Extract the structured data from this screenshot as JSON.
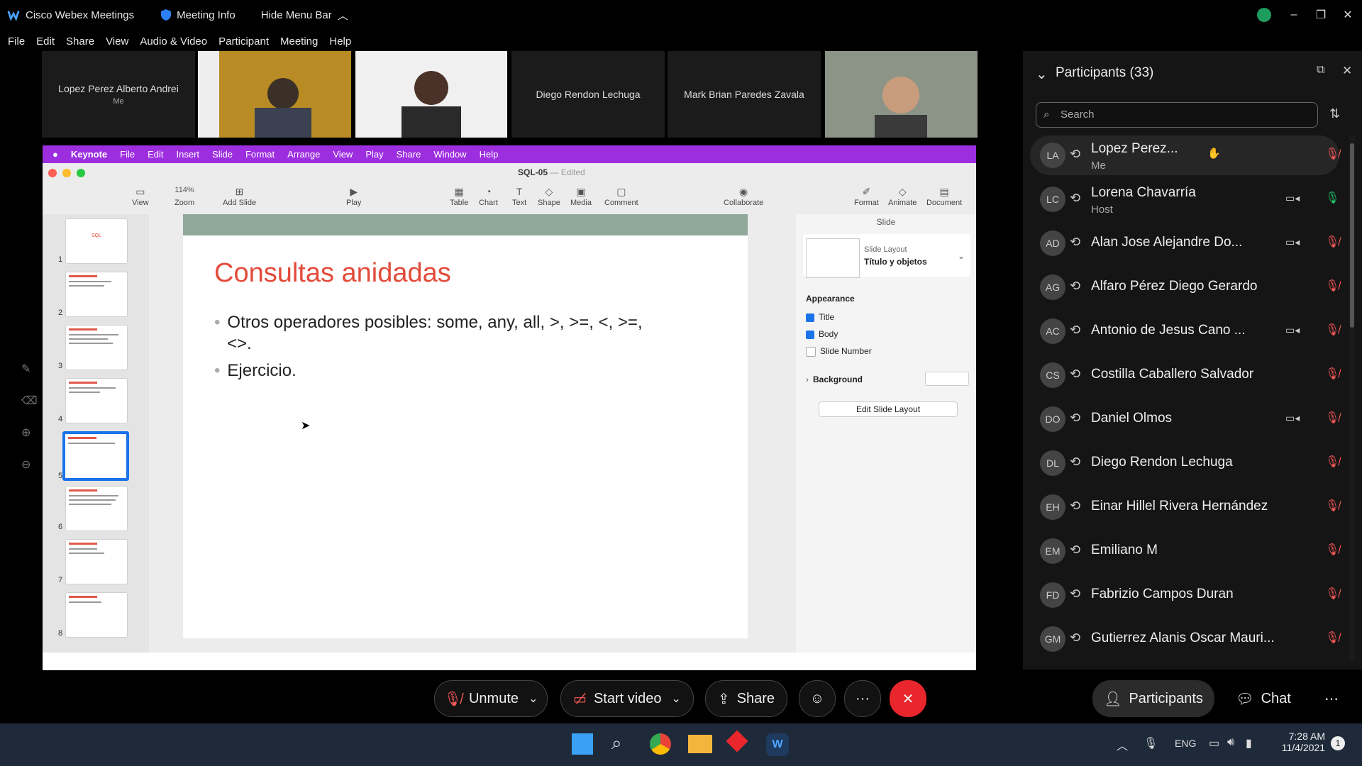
{
  "titlebar": {
    "app": "Cisco Webex Meetings",
    "meeting_info": "Meeting Info",
    "hide_menu": "Hide Menu Bar"
  },
  "menubar": [
    "File",
    "Edit",
    "Share",
    "View",
    "Audio & Video",
    "Participant",
    "Meeting",
    "Help"
  ],
  "videos": [
    {
      "name": "Lopez Perez Alberto Andrei",
      "sub": "Me"
    },
    {
      "name": "Diego Rendon Lechuga"
    },
    {
      "name": "Mark Brian Paredes Zavala"
    }
  ],
  "keynote": {
    "menu": [
      "Keynote",
      "File",
      "Edit",
      "Insert",
      "Slide",
      "Format",
      "Arrange",
      "View",
      "Play",
      "Share",
      "Window",
      "Help"
    ],
    "doc_title": "SQL-05",
    "doc_status": "— Edited",
    "zoom": "114%",
    "tools": {
      "view": "View",
      "zoom": "Zoom",
      "add_slide": "Add Slide",
      "play": "Play",
      "table": "Table",
      "chart": "Chart",
      "text": "Text",
      "shape": "Shape",
      "media": "Media",
      "comment": "Comment",
      "collaborate": "Collaborate",
      "format": "Format",
      "animate": "Animate",
      "document": "Document"
    },
    "slide_numbers": [
      "1",
      "2",
      "3",
      "4",
      "5",
      "6",
      "7",
      "8"
    ],
    "thumb1_text": "SQL",
    "slide": {
      "title": "Consultas anidadas",
      "bullet1": "Otros operadores posibles: some, any, all, >, >=, <, >=,",
      "bullet1b": "<>.",
      "bullet2": "Ejercicio."
    },
    "inspector": {
      "tab": "Slide",
      "layout_label": "Slide Layout",
      "layout_value": "Título y objetos",
      "appearance": "Appearance",
      "title_opt": "Title",
      "body_opt": "Body",
      "slide_number_opt": "Slide Number",
      "background": "Background",
      "edit_layout": "Edit Slide Layout"
    }
  },
  "participants": {
    "header": "Participants (33)",
    "search_placeholder": "Search",
    "list": [
      {
        "initials": "LA",
        "name": "Lopez Perez...",
        "role": "Me",
        "cam": false
      },
      {
        "initials": "LC",
        "name": "Lorena Chavarría",
        "role": "Host",
        "cam": true
      },
      {
        "initials": "AD",
        "name": "Alan Jose Alejandre Do...",
        "role": "",
        "cam": true
      },
      {
        "initials": "AG",
        "name": "Alfaro Pérez Diego Gerardo",
        "role": "",
        "cam": false
      },
      {
        "initials": "AC",
        "name": "Antonio de Jesus Cano ...",
        "role": "",
        "cam": true
      },
      {
        "initials": "CS",
        "name": "Costilla Caballero Salvador",
        "role": "",
        "cam": false
      },
      {
        "initials": "DO",
        "name": "Daniel Olmos",
        "role": "",
        "cam": true
      },
      {
        "initials": "DL",
        "name": "Diego Rendon Lechuga",
        "role": "",
        "cam": false
      },
      {
        "initials": "EH",
        "name": "Einar Hillel Rivera Hernández",
        "role": "",
        "cam": false
      },
      {
        "initials": "EM",
        "name": "Emiliano M",
        "role": "",
        "cam": false
      },
      {
        "initials": "FD",
        "name": "Fabrizio Campos Duran",
        "role": "",
        "cam": false
      },
      {
        "initials": "GM",
        "name": "Gutierrez Alanis Oscar Mauri...",
        "role": "",
        "cam": false
      }
    ]
  },
  "controls": {
    "unmute": "Unmute",
    "start_video": "Start video",
    "share": "Share",
    "more": "···",
    "participants": "Participants",
    "chat": "Chat"
  },
  "taskbar": {
    "lang": "ENG",
    "time": "7:28 AM",
    "date": "11/4/2021",
    "notif": "1"
  },
  "colors": {
    "keynote_menu": "#9c2ee0",
    "slide_title": "#e34b3b",
    "end_red": "#e8262b",
    "selected_thumb": "#1a73e8"
  }
}
